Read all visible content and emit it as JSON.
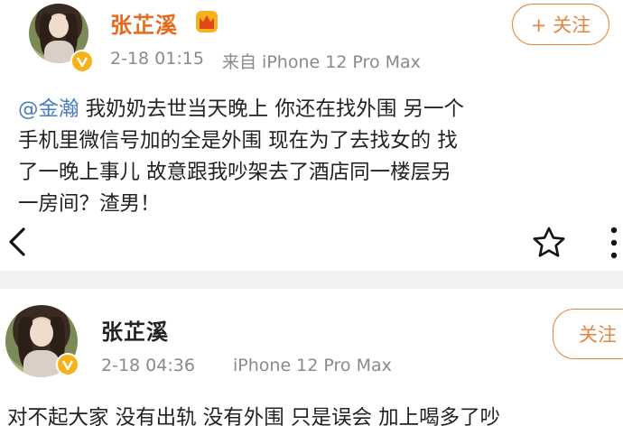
{
  "post1": {
    "user_name": "张芷溪",
    "time": "2-18 01:15",
    "source": "来自 iPhone 12 Pro Max",
    "follow_label": "+ 关注",
    "mention": "@金瀚",
    "content_lines": [
      "我奶奶去世当天晚上 你还在找外围 另一个",
      "手机里微信号加的全是外围 现在为了去找女的 找",
      "了一晚上事儿 故意跟我吵架去了酒店同一楼层另",
      "一房间？渣男！"
    ]
  },
  "post2": {
    "user_name": "张芷溪",
    "time": "2-18 04:36",
    "source": "iPhone 12 Pro Max",
    "follow_label": "关注",
    "content_line": "对不起大家 没有出轨 没有外围 只是误会 加上喝多了吵"
  },
  "icons": {
    "back": "chevron-left-icon",
    "favorite": "star-outline-icon",
    "more": "ellipsis-vertical-icon",
    "verified": "verified-v-icon",
    "crown": "crown-vip-icon"
  },
  "colors": {
    "vip_name": "#e8691c",
    "follow": "#e6853a",
    "mention": "#4a7bbf",
    "meta": "#8a8a8a",
    "verified": "#f7b11a"
  }
}
